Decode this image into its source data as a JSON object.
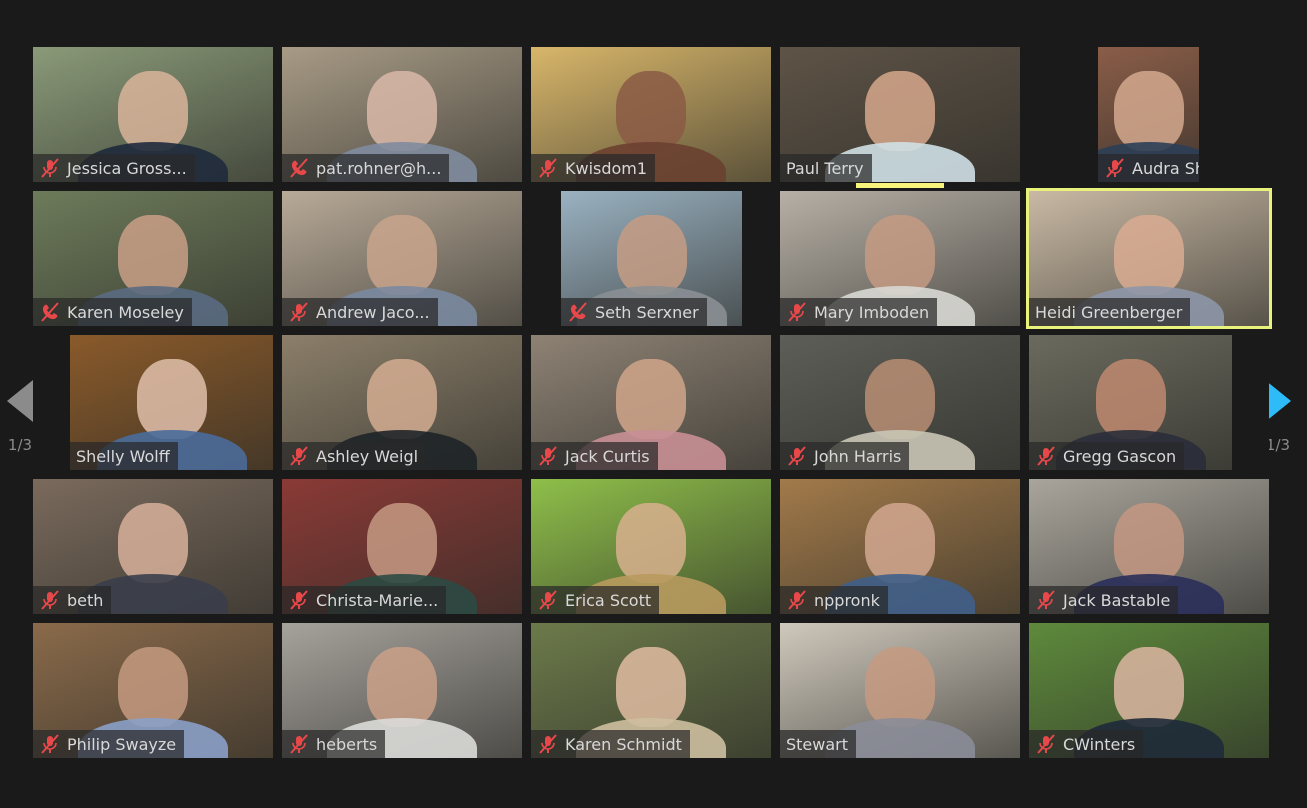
{
  "gallery": {
    "page_indicator_left": "1/3",
    "page_indicator_right": "1/3",
    "accent_color": "#2dbcf8",
    "active_speaker_color": "#e9f27a",
    "muted_icon_color": "#e8484a",
    "participants": [
      {
        "name": "Jessica Gross...",
        "status": "mic-muted",
        "bg": "#8a9a78",
        "skin": "#d8b49a",
        "shirt": "#1f2a3c"
      },
      {
        "name": "pat.rohner@h...",
        "status": "phone-muted",
        "bg": "#a89b86",
        "skin": "#d9b8a8",
        "shirt": "#7f8c9e"
      },
      {
        "name": "Kwisdom1",
        "status": "mic-muted",
        "bg": "#d8b66a",
        "skin": "#8a5a44",
        "shirt": "#6a4030"
      },
      {
        "name": "Paul Terry",
        "status": "none",
        "bg": "#5e5346",
        "skin": "#d6a88c",
        "shirt": "#cfe0e6",
        "speaking": true
      },
      {
        "name": "Audra Shane...",
        "status": "mic-muted",
        "bg": "#8a5d48",
        "skin": "#d4a98e",
        "shirt": "#2c3e56"
      },
      {
        "name": "Karen Moseley",
        "status": "phone-muted",
        "bg": "#6d7b5a",
        "skin": "#c99f86",
        "shirt": "#5a6a82"
      },
      {
        "name": "Andrew Jaco...",
        "status": "mic-muted",
        "bg": "#b8aa98",
        "skin": "#c9a48c",
        "shirt": "#7a8aa0"
      },
      {
        "name": "Seth Serxner",
        "status": "phone-muted",
        "bg": "#9ab2c2",
        "skin": "#c59c84",
        "shirt": "#8a8f94"
      },
      {
        "name": "Mary Imboden",
        "status": "mic-muted",
        "bg": "#b7b0a6",
        "skin": "#c49a82",
        "shirt": "#d8d8d4"
      },
      {
        "name": "Heidi Greenberger",
        "status": "none",
        "bg": "#c9b9a4",
        "skin": "#d9ac92",
        "shirt": "#8d96a8",
        "active": true
      },
      {
        "name": "Shelly Wolff",
        "status": "none",
        "bg": "#8a5a2a",
        "skin": "#e0c0aa",
        "shirt": "#4a6c9a"
      },
      {
        "name": "Ashley Weigl",
        "status": "mic-muted",
        "bg": "#8c7f6a",
        "skin": "#d4ad92",
        "shirt": "#1e2428"
      },
      {
        "name": "Jack Curtis",
        "status": "mic-muted",
        "bg": "#8e8274",
        "skin": "#d0a48a",
        "shirt": "#c88f94"
      },
      {
        "name": "John Harris",
        "status": "mic-muted",
        "bg": "#5e5e58",
        "skin": "#b88e74",
        "shirt": "#c9c5b6"
      },
      {
        "name": "Gregg Gascon",
        "status": "mic-muted",
        "bg": "#6a6a5e",
        "skin": "#c08a70",
        "shirt": "#2a2c3a"
      },
      {
        "name": "beth",
        "status": "mic-muted",
        "bg": "#7a6a5c",
        "skin": "#d7b09a",
        "shirt": "#3a3e4a"
      },
      {
        "name": "Christa-Marie...",
        "status": "mic-muted",
        "bg": "#8a3a36",
        "skin": "#c69a84",
        "shirt": "#2c4a44"
      },
      {
        "name": "Erica Scott",
        "status": "mic-muted",
        "bg": "#8fbf4a",
        "skin": "#d8b08e",
        "shirt": "#b89a5e"
      },
      {
        "name": "nppronk",
        "status": "mic-muted",
        "bg": "#a27a4a",
        "skin": "#d2a890",
        "shirt": "#3f5f8a"
      },
      {
        "name": "Jack Bastable",
        "status": "mic-muted",
        "bg": "#a9a59c",
        "skin": "#c49882",
        "shirt": "#2a2f5a"
      },
      {
        "name": "Philip Swayze",
        "status": "mic-muted",
        "bg": "#8a6a4a",
        "skin": "#c49a80",
        "shirt": "#8aa0c8"
      },
      {
        "name": "heberts",
        "status": "mic-muted",
        "bg": "#a6a29c",
        "skin": "#caa088",
        "shirt": "#dadcd8"
      },
      {
        "name": "Karen Schmidt",
        "status": "mic-muted",
        "bg": "#6c7a4a",
        "skin": "#e0bca2",
        "shirt": "#cdbfa0"
      },
      {
        "name": "Stewart",
        "status": "none",
        "bg": "#cfc8bc",
        "skin": "#c59a80",
        "shirt": "#8a8c98"
      },
      {
        "name": "CWinters",
        "status": "mic-muted",
        "bg": "#5e8a3c",
        "skin": "#dcb6a2",
        "shirt": "#1e2a3a"
      }
    ]
  }
}
